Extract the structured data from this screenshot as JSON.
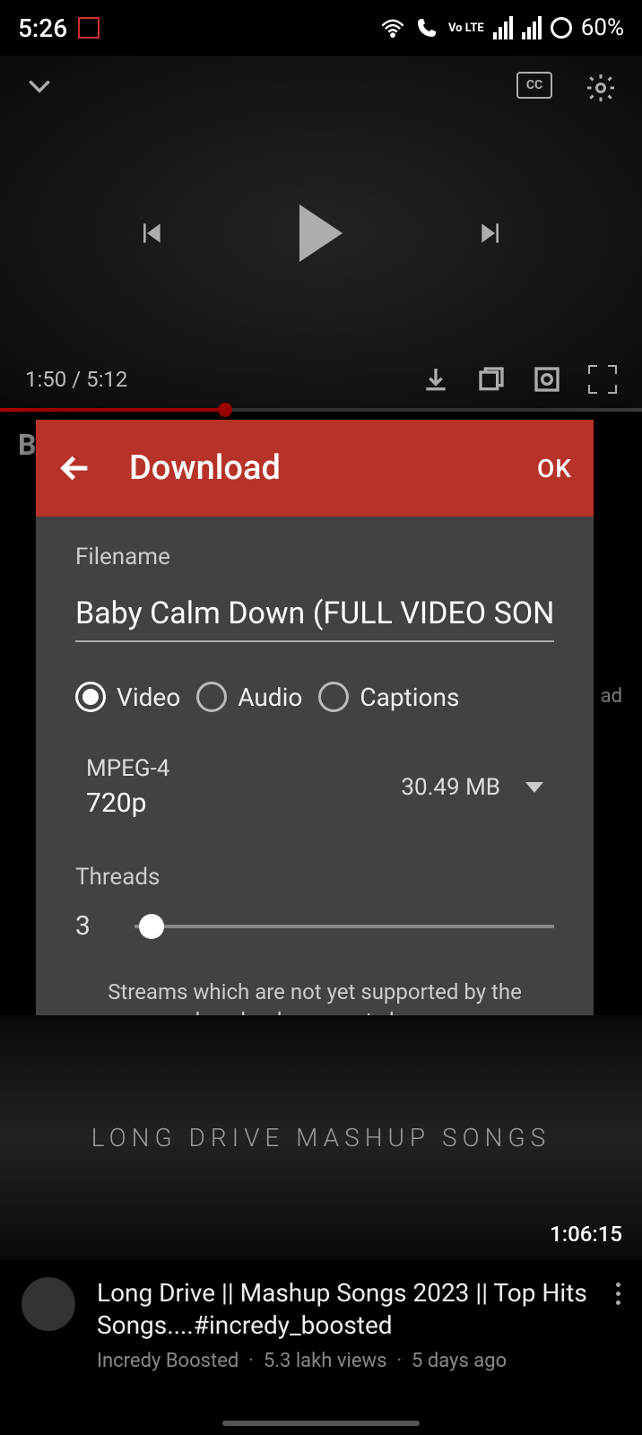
{
  "status": {
    "time": "5:26",
    "battery": "60%",
    "volte": "Vo LTE"
  },
  "player": {
    "current_time": "1:50",
    "total_time": "5:12",
    "cc_label": "CC"
  },
  "bg": {
    "title_first_letter": "B",
    "ad_label": "ad"
  },
  "dialog": {
    "title": "Download",
    "ok": "OK",
    "filename_label": "Filename",
    "filename_value": "Baby Calm Down (FULL VIDEO SONG)",
    "radios": {
      "video": "Video",
      "audio": "Audio",
      "captions": "Captions",
      "selected": "video"
    },
    "format": {
      "container": "MPEG-4",
      "resolution": "720p",
      "size": "30.49 MB"
    },
    "threads_label": "Threads",
    "threads_value": "3",
    "note": "Streams which are not yet supported by the downloader are not shown"
  },
  "list": {
    "thumb_text": "LONG DRIVE MASHUP SONGS",
    "duration": "1:06:15",
    "title": "Long Drive || Mashup Songs 2023 || Top Hits Songs....#incredy_boosted",
    "channel": "Incredy Boosted",
    "views": "5.3 lakh views",
    "age": "5 days ago"
  }
}
